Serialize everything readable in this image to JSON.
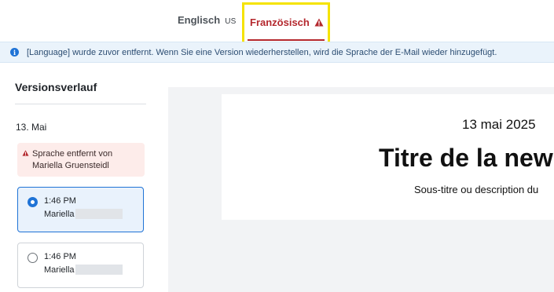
{
  "tabs": {
    "english": {
      "label": "Englisch",
      "region": "US"
    },
    "french": {
      "label": "Französisch",
      "status_icon": "warning-triangle-icon"
    }
  },
  "banner": {
    "icon": "info-icon",
    "text": "[Language] wurde zuvor entfernt. Wenn Sie eine Version wiederherstellen, wird die Sprache der E-Mail wieder hinzugefügt."
  },
  "sidebar": {
    "title": "Versionsverlauf",
    "date_heading": "13. Mai",
    "notice": {
      "icon": "warning-triangle-icon",
      "text": "Sprache entfernt von Mariella Gruensteidl"
    },
    "versions": [
      {
        "time": "1:46 PM",
        "author": "Mariella",
        "selected": true
      },
      {
        "time": "1:46 PM",
        "author": "Mariella",
        "selected": false
      }
    ]
  },
  "preview": {
    "date": "13 mai 2025",
    "title": "Titre de la new",
    "subtitle": "Sous-titre ou description du"
  },
  "colors": {
    "accent_blue": "#1f73d6",
    "warning_red": "#b4282e",
    "highlight_yellow": "#f5e300",
    "banner_bg": "#eaf3fb",
    "notice_bg": "#fdecea"
  }
}
